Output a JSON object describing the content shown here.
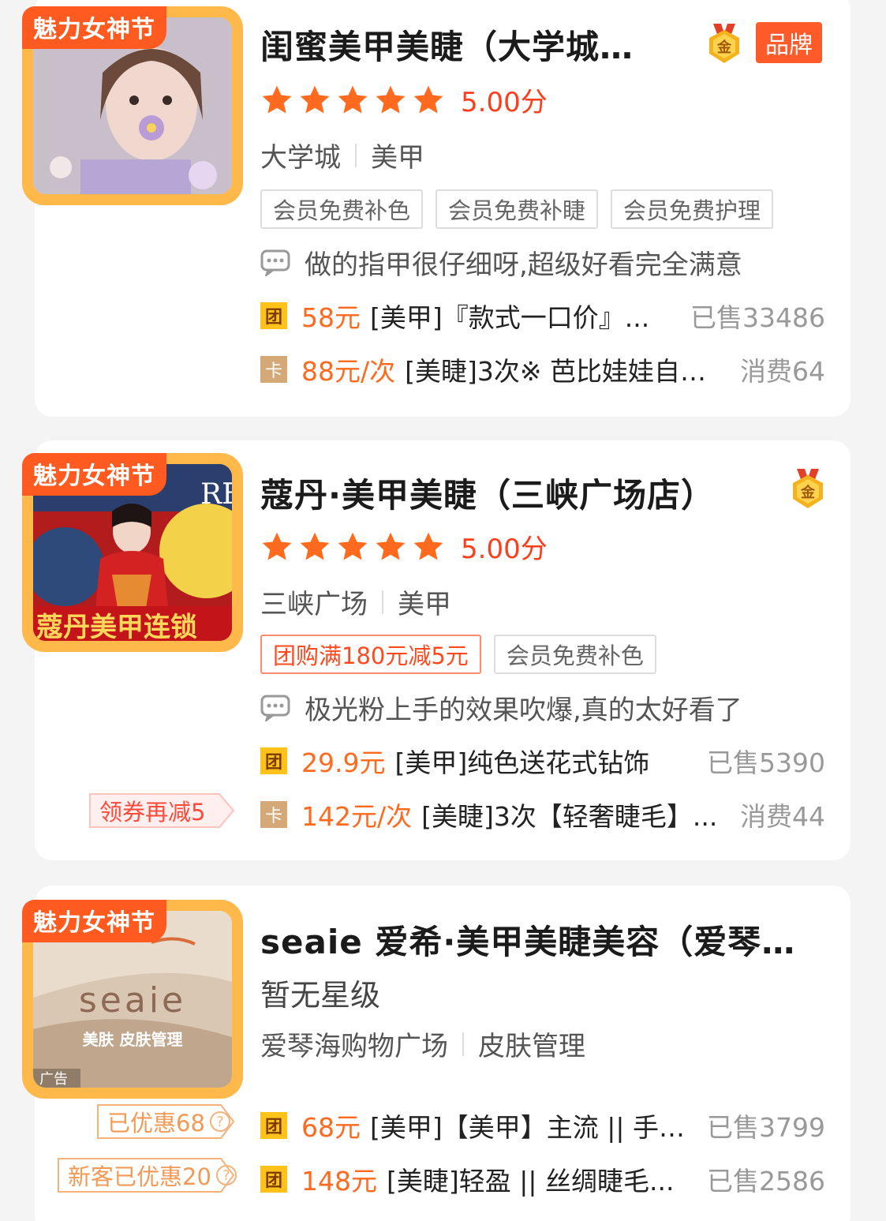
{
  "listings": [
    {
      "thumb_tag": "魅力女神节",
      "title": "闺蜜美甲美睫（大学城…",
      "gold_badge": "金",
      "brand_badge": "品牌",
      "score": "5.00分",
      "area": "大学城",
      "category": "美甲",
      "tags": [
        "会员免费补色",
        "会员免费补睫",
        "会员免费护理"
      ],
      "review": "做的指甲很仔细呀,超级好看完全满意",
      "deals": [
        {
          "icon": "团",
          "price": "58元",
          "name": "[美甲]『款式一口价』...",
          "sold": "已售33486"
        },
        {
          "icon": "卡",
          "price": "88元/次",
          "name": "[美睫]3次※ 芭比娃娃自…",
          "sold": "消费64"
        }
      ]
    },
    {
      "thumb_tag": "魅力女神节",
      "thumb_text": "蔻丹美甲连锁",
      "thumb_corner": "RE",
      "title": "蔻丹·美甲美睫（三峡广场店）",
      "gold_badge": "金",
      "score": "5.00分",
      "area": "三峡广场",
      "category": "美甲",
      "promo_tag": "团购满180元减5元",
      "tags": [
        "会员免费补色"
      ],
      "review": "极光粉上手的效果吹爆,真的太好看了",
      "coupon": "领券再减5",
      "deals": [
        {
          "icon": "团",
          "price": "29.9元",
          "name": "[美甲]纯色送花式钻饰",
          "sold": "已售5390"
        },
        {
          "icon": "卡",
          "price": "142元/次",
          "name": "[美睫]3次【轻奢睫毛】...",
          "sold": "消费44"
        }
      ]
    },
    {
      "thumb_tag": "魅力女神节",
      "thumb_logo": "seaie",
      "thumb_sub": "美肤 皮肤管理",
      "thumb_ad": "广告",
      "title": "seaie 爱希·美甲美睫美容（爱琴…",
      "no_rating": "暂无星级",
      "area": "爱琴海购物广场",
      "category": "皮肤管理",
      "coupons": [
        {
          "label": "已优惠68",
          "help": "?"
        },
        {
          "label": "新客已优惠20",
          "help": "?"
        }
      ],
      "deals": [
        {
          "icon": "团",
          "price": "68元",
          "name": "[美甲]【美甲】主流 || 手…",
          "sold": "已售3799"
        },
        {
          "icon": "团",
          "price": "148元",
          "name": "[美睫]轻盈 || 丝绸睫毛...",
          "sold": "已售2586"
        }
      ]
    }
  ],
  "colors": {
    "accent_orange": "#ff5a1f",
    "price_orange": "#ff6a1f",
    "star_orange": "#ff6a1f",
    "score_red": "#ff3d1a",
    "thumb_frame": "#ffb84a"
  },
  "icons": {
    "star": "star-icon",
    "review": "chat-bubble-icon",
    "gold_medal": "gold-medal-icon"
  }
}
